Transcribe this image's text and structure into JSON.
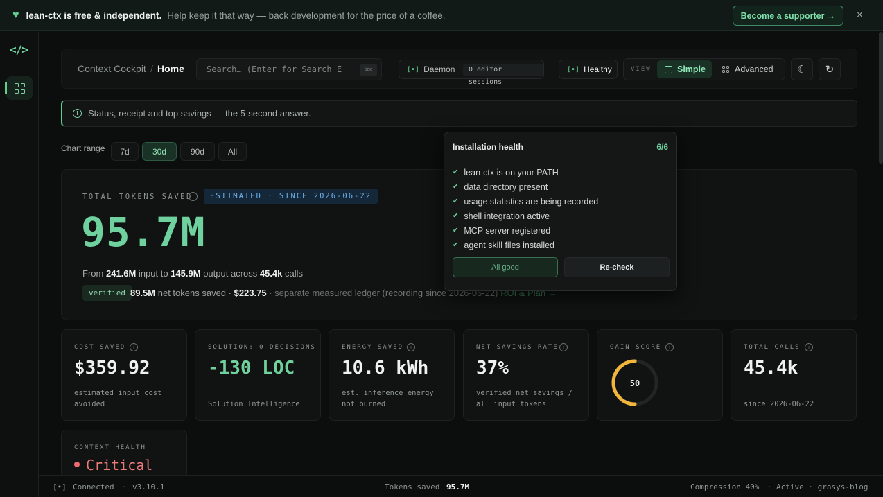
{
  "banner": {
    "title": "lean-ctx is free & independent.",
    "message": "Help keep it that way — back development for the price of a coffee.",
    "cta": "Become a supporter →",
    "close": "×"
  },
  "sidebar": {
    "logo": "</>",
    "items": [
      {
        "icon": "grid-icon",
        "label": "Home"
      }
    ]
  },
  "header": {
    "breadcrumb_root": "Context Cockpit",
    "breadcrumb_sep": "/",
    "breadcrumb_current": "Home",
    "search_placeholder": "Search… (Enter for Search E",
    "search_kbd": "⌘K",
    "daemon_mark": "[•]",
    "daemon_label": "Daemon",
    "sessions": "0 editor sessions",
    "health_mark": "[•]",
    "health": "Healthy",
    "view_label": "VIEW",
    "view_simple": "Simple",
    "view_advanced": "Advanced"
  },
  "info_banner": "Status, receipt and top savings — the 5-second answer.",
  "range": {
    "label": "Chart range",
    "options": [
      "7d",
      "30d",
      "90d",
      "All"
    ],
    "selected": "30d"
  },
  "hero": {
    "label": "TOTAL TOKENS SAVED",
    "tag": "ESTIMATED · SINCE 2026-06-22",
    "value": "95.7M",
    "from_prefix": "From ",
    "input": "241.6M",
    "mid1": " input to ",
    "output": "145.9M",
    "mid2": " output across ",
    "calls": "45.4k",
    "suffix": " calls",
    "verified_badge": "verified",
    "net": "89.5M",
    "net_text": " net tokens saved · ",
    "net_money": "$223.75",
    "ledger": " · separate measured ledger (recording since 2026-06-22)",
    "roi_link": "ROI & Plan →"
  },
  "cards": [
    {
      "label": "COST SAVED",
      "value": "$359.92",
      "sub1": "estimated input cost",
      "sub2": "avoided"
    },
    {
      "label": "SOLUTION: 0 DECISIONS",
      "value": "-130 LOC",
      "sub1": "",
      "sub2": "Solution Intelligence"
    },
    {
      "label": "ENERGY SAVED",
      "value": "10.6 kWh",
      "sub1": "est. inference energy",
      "sub2": "not burned"
    },
    {
      "label": "NET SAVINGS RATE",
      "value": "37%",
      "sub1": "verified net savings /",
      "sub2": "all input tokens"
    },
    {
      "label": "GAIN SCORE",
      "value": "50",
      "gauge_fraction": 0.5,
      "gauge_color": "#f2b53c"
    },
    {
      "label": "TOTAL CALLS",
      "value": "45.4k",
      "sub1": "",
      "sub2": "since 2026-06-22"
    }
  ],
  "context_health": {
    "label": "CONTEXT HEALTH",
    "value": "Critical",
    "color": "#ef6b6b"
  },
  "popover": {
    "title": "Installation health",
    "count": "6/6",
    "items": [
      "lean-ctx is on your PATH",
      "data directory present",
      "usage statistics are being recorded",
      "shell integration active",
      "MCP server registered",
      "agent skill files installed"
    ],
    "button_ok": "All good",
    "button_recheck": "Re-check"
  },
  "status": {
    "conn_mark": "[•]",
    "connected": "Connected",
    "sep": "·",
    "version": "v3.10.1",
    "tokens_label": "Tokens saved",
    "tokens_value": "95.7M",
    "compression": "Compression 40%",
    "active": "Active · grasys-blog"
  }
}
